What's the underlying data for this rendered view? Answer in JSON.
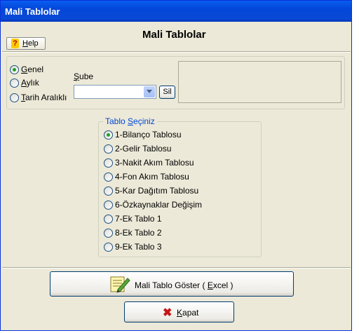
{
  "window": {
    "title": "Mali Tablolar"
  },
  "header": {
    "title": "Mali Tablolar",
    "help_label": "Help",
    "help_accel": "H",
    "help_rest": "elp"
  },
  "period": {
    "options": [
      {
        "accel": "G",
        "rest": "enel",
        "selected": true
      },
      {
        "accel": "A",
        "rest": "ylık",
        "selected": false
      },
      {
        "accel": "T",
        "rest": "arih Aralıklı",
        "selected": false
      }
    ]
  },
  "branch": {
    "label_accel": "Ş",
    "label_rest": "ube",
    "value": "",
    "clear_button": "Sil"
  },
  "table_select": {
    "label_pre": "Tablo ",
    "label_accel": "S",
    "label_post": "eçiniz",
    "options": [
      {
        "label": "1-Bilanço Tablosu",
        "selected": true
      },
      {
        "label": "2-Gelir Tablosu",
        "selected": false
      },
      {
        "label": "3-Nakit Akım Tablosu",
        "selected": false
      },
      {
        "label": "4-Fon Akım Tablosu",
        "selected": false
      },
      {
        "label": "5-Kar Dağıtım Tablosu",
        "selected": false
      },
      {
        "label": "6-Özkaynaklar Değişim",
        "selected": false
      },
      {
        "label": "7-Ek Tablo 1",
        "selected": false
      },
      {
        "label": "8-Ek Tablo 2",
        "selected": false
      },
      {
        "label": "9-Ek Tablo 3",
        "selected": false
      }
    ]
  },
  "actions": {
    "show_pre": "Mali Tablo Göster ( ",
    "show_accel": "E",
    "show_post": "xcel )",
    "close_accel": "K",
    "close_rest": "apat"
  },
  "icons": {
    "help": "help-icon",
    "show": "notepad-pencil-icon",
    "close": "red-x-icon"
  }
}
